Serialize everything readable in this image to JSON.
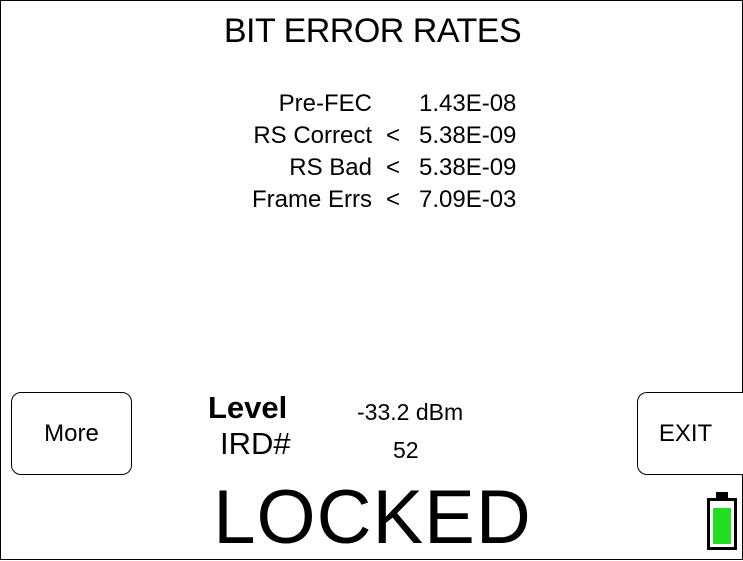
{
  "screen": {
    "title": "BIT ERROR RATES"
  },
  "ber": {
    "rows": [
      {
        "label": "Pre-FEC",
        "cmp": "",
        "value": "1.43E-08"
      },
      {
        "label": "RS Correct",
        "cmp": "<",
        "value": "5.38E-09"
      },
      {
        "label": "RS Bad",
        "cmp": "<",
        "value": "5.38E-09"
      },
      {
        "label": "Frame Errs",
        "cmp": "<",
        "value": "7.09E-03"
      }
    ]
  },
  "buttons": {
    "more_label": "More",
    "exit_label": "EXIT"
  },
  "signal": {
    "level_label": "Level",
    "level_value": "-33.2 dBm",
    "ird_label": "IRD#",
    "ird_value": "52"
  },
  "status": {
    "text": "LOCKED"
  },
  "battery": {
    "icon": "battery-icon",
    "charge_fraction": 0.9,
    "fill_color": "#22dd22"
  }
}
